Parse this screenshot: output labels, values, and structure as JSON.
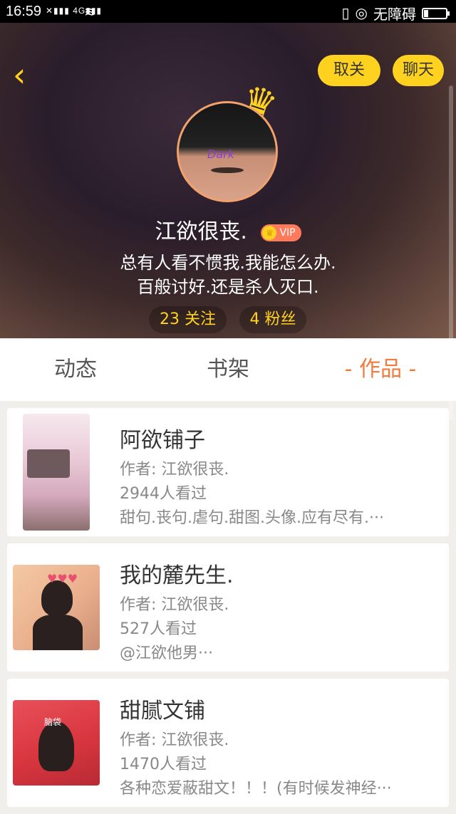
{
  "status_bar": {
    "time": "16:59",
    "signal_text": "4G",
    "accessibility": "无障碍"
  },
  "header": {
    "unfollow_label": "取关",
    "chat_label": "聊天",
    "username": "江欲很丧.",
    "vip_label": "VIP",
    "avatar_text": "Dark",
    "bio_line1": "总有人看不惯我.我能怎么办.",
    "bio_line2": "百般讨好.还是杀人灭口.",
    "following": "23 关注",
    "followers": "4 粉丝"
  },
  "tabs": [
    {
      "label": "动态"
    },
    {
      "label": "书架"
    },
    {
      "label": "- 作品 -"
    }
  ],
  "works": [
    {
      "title": "阿欲铺子",
      "author": "作者: 江欲很丧.",
      "views": "2944人看过",
      "desc": "甜句.丧句.虐句.甜图.头像.应有尽有.···"
    },
    {
      "title": "我的麓先生.",
      "author": "作者: 江欲很丧.",
      "views": "527人看过",
      "desc": "@江欲他男···"
    },
    {
      "title": "甜腻文铺",
      "author": "作者: 江欲很丧.",
      "views": "1470人看过",
      "desc": "各种恋爱蔽甜文！！！(有时候发神经···"
    }
  ],
  "thumb3_text": "脑袋",
  "colors": {
    "accent_yellow": "#ffd21f",
    "accent_orange": "#f47a3b"
  }
}
